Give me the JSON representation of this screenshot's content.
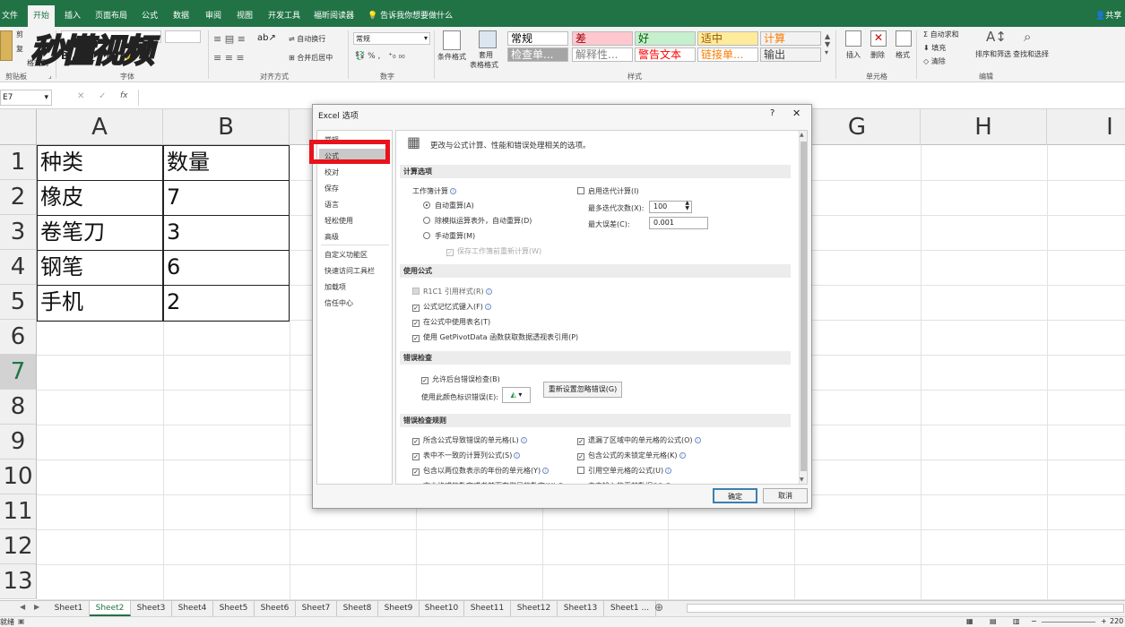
{
  "ribbon": {
    "tabs": [
      "文件",
      "开始",
      "插入",
      "页面布局",
      "公式",
      "数据",
      "审阅",
      "视图",
      "开发工具",
      "福昕阅读器"
    ],
    "active_tab": "开始",
    "tell_me": "告诉我你想要做什么",
    "share": "共享",
    "groups": {
      "clipboard": "剪贴板",
      "font": "字体",
      "alignment": "对齐方式",
      "number": "数字",
      "styles": "样式",
      "cells": "单元格",
      "editing": "编辑"
    },
    "clipboard": {
      "cut": "剪",
      "copy": "复",
      "format_painter": "格式刷"
    },
    "alignment": {
      "wrap": "自动换行",
      "merge": "合并后居中"
    },
    "number_format": "常规",
    "number_symbols": {
      "percent": "%",
      "comma": ","
    },
    "styles": {
      "conditional": "条件格式",
      "table_format_1": "套用",
      "table_format_2": "表格格式",
      "cells": [
        {
          "text": "常规",
          "bg": "#ffffff",
          "color": "#000000"
        },
        {
          "text": "差",
          "bg": "#ffc7ce",
          "color": "#9c0006"
        },
        {
          "text": "好",
          "bg": "#c6efce",
          "color": "#006100"
        },
        {
          "text": "适中",
          "bg": "#ffeb9c",
          "color": "#9c5700"
        },
        {
          "text": "计算",
          "bg": "#f2f2f2",
          "color": "#fa7d00"
        },
        {
          "text": "检查单...",
          "bg": "#a5a5a5",
          "color": "#ffffff"
        },
        {
          "text": "解释性...",
          "bg": "#ffffff",
          "color": "#7f7f7f"
        },
        {
          "text": "警告文本",
          "bg": "#ffffff",
          "color": "#ff0000"
        },
        {
          "text": "链接单...",
          "bg": "#ffffff",
          "color": "#fa7d00"
        },
        {
          "text": "输出",
          "bg": "#f2f2f2",
          "color": "#3f3f3f"
        }
      ]
    },
    "cells_group": {
      "insert": "插入",
      "delete": "删除",
      "format": "格式"
    },
    "editing": {
      "autosum": "自动求和",
      "fill": "填充",
      "clear": "清除",
      "sort": "排序和筛选",
      "find": "查找和选择"
    }
  },
  "watermark": "秒懂视频",
  "formula_bar": {
    "name_box": "E7",
    "fx": "fx"
  },
  "sheet": {
    "columns": [
      "A",
      "B",
      "C",
      "D",
      "E",
      "F",
      "G",
      "H",
      "I"
    ],
    "rows": [
      "1",
      "2",
      "3",
      "4",
      "5",
      "6",
      "7",
      "8",
      "9",
      "10",
      "11",
      "12",
      "13"
    ],
    "cells": [
      [
        "种类",
        "数量"
      ],
      [
        "橡皮",
        "7"
      ],
      [
        "卷笔刀",
        "3"
      ],
      [
        "钢笔",
        "6"
      ],
      [
        "手机",
        "2"
      ]
    ]
  },
  "sheet_tabs": [
    "Sheet1",
    "Sheet2",
    "Sheet3",
    "Sheet4",
    "Sheet5",
    "Sheet6",
    "Sheet7",
    "Sheet8",
    "Sheet9",
    "Sheet10",
    "Sheet11",
    "Sheet12",
    "Sheet13",
    "Sheet1 ..."
  ],
  "active_sheet": "Sheet2",
  "status": {
    "left": "就绪",
    "zoom": "220"
  },
  "dialog": {
    "title": "Excel 选项",
    "help": "?",
    "close": "✕",
    "nav": [
      "常规",
      "公式",
      "校对",
      "保存",
      "语言",
      "轻松使用",
      "高级",
      "自定义功能区",
      "快速访问工具栏",
      "加载项",
      "信任中心"
    ],
    "selected_nav": "公式",
    "header": "更改与公式计算、性能和错误处理相关的选项。",
    "calc_section": "计算选项",
    "workbook_calc": "工作簿计算",
    "calc_auto": "自动重算(A)",
    "calc_except": "除模拟运算表外，自动重算(D)",
    "calc_manual": "手动重算(M)",
    "calc_save": "保存工作簿前重新计算(W)",
    "iterative": "启用迭代计算(I)",
    "max_iter_label": "最多迭代次数(X):",
    "max_iter": "100",
    "max_change_label": "最大误差(C):",
    "max_change": "0.001",
    "formulas_section": "使用公式",
    "r1c1": "R1C1 引用样式(R)",
    "autocomplete": "公式记忆式键入(F)",
    "table_names": "在公式中使用表名(T)",
    "getpivot": "使用 GetPivotData 函数获取数据透视表引用(P)",
    "errcheck_section": "错误检查",
    "bg_errcheck": "允许后台错误检查(B)",
    "err_color": "使用此颜色标识错误(E):",
    "reset_btn": "重新设置忽略错误(G)",
    "rules_section": "错误检查规则",
    "rules_left": [
      "所含公式导致错误的单元格(L)",
      "表中不一致的计算列公式(S)",
      "包含以两位数表示的年份的单元格(Y)",
      "文本格式的数字或者前面有撇号的数字(H)"
    ],
    "rules_right": [
      "遗漏了区域中的单元格的公式(O)",
      "包含公式的未锁定单元格(K)",
      "引用空单元格的公式(U)",
      "表中输入的无效数据(V)"
    ],
    "rules_left_checked": [
      true,
      true,
      true,
      true
    ],
    "rules_right_checked": [
      true,
      true,
      false,
      true
    ],
    "ok": "确定",
    "cancel": "取消"
  },
  "colors": {
    "excel_green": "#217346",
    "highlight_red": "#e8131b"
  }
}
